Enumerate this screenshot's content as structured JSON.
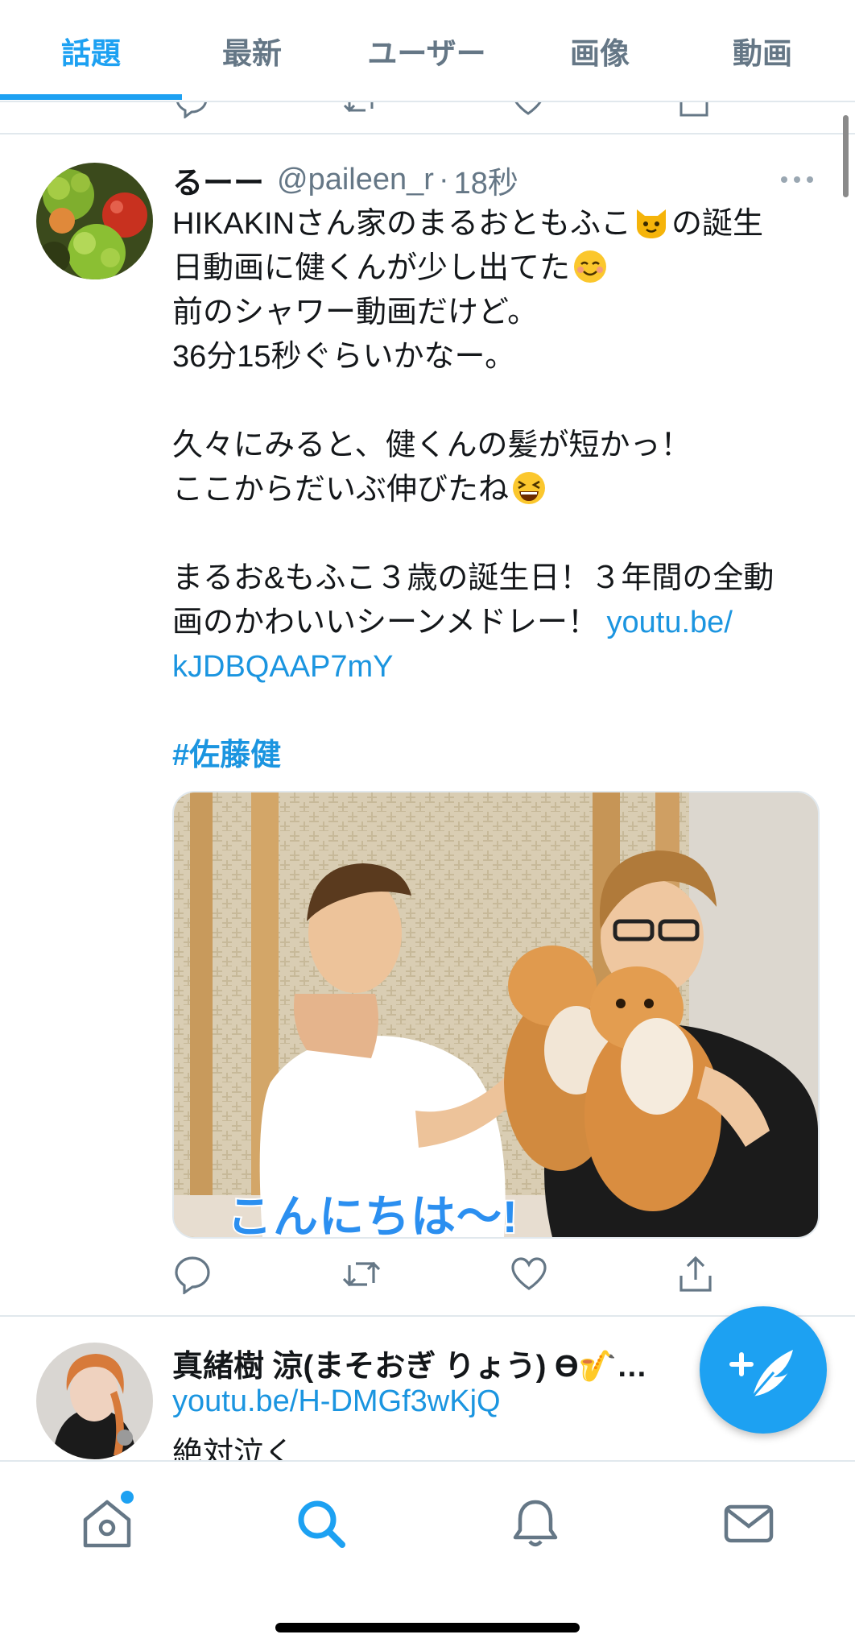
{
  "tabs": [
    {
      "label": "話題",
      "active": true
    },
    {
      "label": "最新",
      "active": false
    },
    {
      "label": "ユーザー",
      "active": false
    },
    {
      "label": "画像",
      "active": false
    },
    {
      "label": "動画",
      "active": false
    }
  ],
  "tweet": {
    "display_name": "るーー",
    "handle": "@paileen_r",
    "separator": "·",
    "time": "18秒",
    "body": {
      "l1a": "HIKAKINさん家のまるおともふこ",
      "l1b": "の誕生",
      "l2": "日動画に健くんが少し出てた",
      "l3": "前のシャワー動画だけど。",
      "l4": "36分15秒ぐらいかなー。",
      "l5": "久々にみると、健くんの髪が短かっ！",
      "l6": "ここからだいぶ伸びたね",
      "l7": "まるお&もふこ３歳の誕生日！３年間の全動",
      "l8": "画のかわいいシーンメドレー！",
      "link_part1": "youtu.be/",
      "link_part2": "kJDBQAAP7mY",
      "hashtag": "#佐藤健"
    },
    "emoji_names": [
      "cat-face-emoji",
      "smiling-face-emoji",
      "grinning-squinting-face-emoji"
    ],
    "media_caption": "こんにちは〜!",
    "action_icons": [
      "reply-icon",
      "retweet-icon",
      "like-icon",
      "share-icon"
    ]
  },
  "next_tweet": {
    "display_name": "真緒樹 涼(まそおぎ りょう) ϴ🎷…",
    "link": "youtu.be/H-DMGf3wKjQ",
    "text": "絶対泣く"
  },
  "fab_icon": "compose-tweet-icon",
  "bottom_nav": [
    "home-icon",
    "search-icon",
    "notifications-icon",
    "messages-icon"
  ],
  "colors": {
    "accent": "#1da1f2",
    "link": "#1b95e0",
    "secondary_text": "#657786",
    "divider": "#e1e8ed"
  }
}
